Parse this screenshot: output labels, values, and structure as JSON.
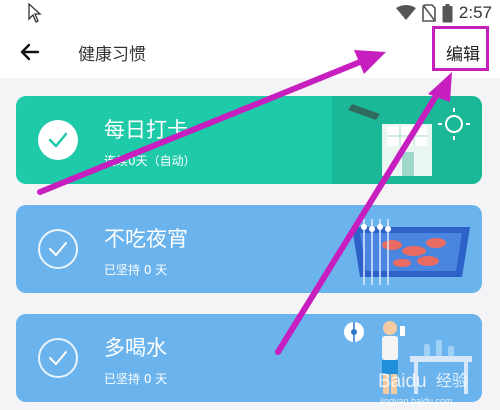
{
  "status": {
    "time": "2:57",
    "icons": [
      "wifi-icon",
      "sim-off-icon",
      "battery-icon"
    ]
  },
  "appbar": {
    "title": "健康习惯",
    "edit_label": "编辑",
    "back_icon": "arrow-left-icon"
  },
  "cards": [
    {
      "title": "每日打卡",
      "subtitle": "连续0天（自动）",
      "checked": true,
      "color": "#1ecaa8",
      "illustration": "checkin-building-icon"
    },
    {
      "title": "不吃夜宵",
      "subtitle": "已坚持 0 天",
      "checked": false,
      "color": "#6ab3ec",
      "illustration": "bbq-skewers-icon"
    },
    {
      "title": "多喝水",
      "subtitle": "已坚持 0 天",
      "checked": false,
      "color": "#6ab3ec",
      "illustration": "person-drinking-water-icon"
    }
  ],
  "annotation": {
    "color": "#c71fbf"
  },
  "watermark": {
    "text": "Baidu经验",
    "sub": "jingyan.baidu.com"
  }
}
